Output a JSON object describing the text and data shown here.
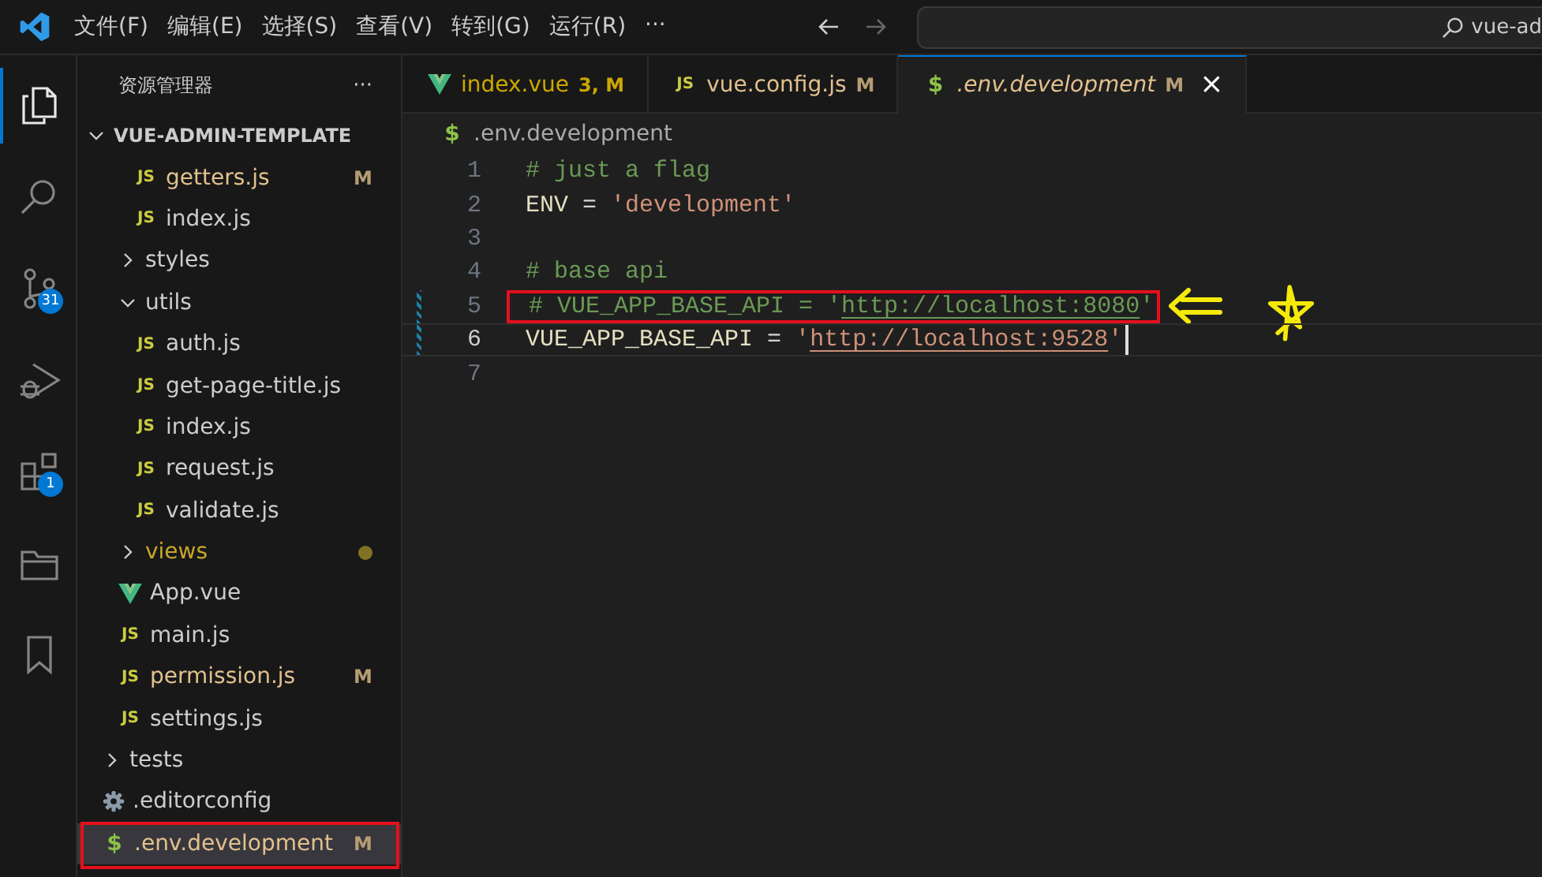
{
  "menu_bar": {
    "items": [
      "文件(F)",
      "编辑(E)",
      "选择(S)",
      "查看(V)",
      "转到(G)",
      "运行(R)",
      "···"
    ],
    "search": {
      "value": "vue-ad"
    }
  },
  "activity_bar": [
    {
      "kind": "files",
      "selected": true
    },
    {
      "kind": "search",
      "selected": false
    },
    {
      "kind": "source-control",
      "selected": false,
      "badge": "31"
    },
    {
      "kind": "debug",
      "selected": false
    },
    {
      "kind": "extensions",
      "selected": false,
      "badge": "1"
    },
    {
      "kind": "folder",
      "selected": false
    },
    {
      "kind": "bookmark",
      "selected": false
    }
  ],
  "sidebar": {
    "title": "资源管理器",
    "more": "···",
    "root": {
      "name": "VUE-ADMIN-TEMPLATE",
      "kind": "folder",
      "expanded": true,
      "children": [
        {
          "kind": "folder",
          "children": [
            {
              "kind": "folder",
              "children": [
                {
                  "name": "getters.js",
                  "kind": "js",
                  "icon": "JS",
                  "status": "M",
                  "selected": false
                },
                {
                  "name": "index.js",
                  "kind": "js",
                  "icon": "JS",
                  "selected": false
                }
              ]
            },
            {
              "name": "styles",
              "kind": "folder",
              "expanded": false
            },
            {
              "name": "utils",
              "kind": "folder",
              "expanded": true,
              "children": [
                {
                  "name": "auth.js",
                  "kind": "js",
                  "icon": "JS",
                  "selected": false
                },
                {
                  "name": "get-page-title.js",
                  "kind": "js",
                  "icon": "JS",
                  "selected": false
                },
                {
                  "name": "index.js",
                  "kind": "js",
                  "icon": "JS",
                  "selected": false
                },
                {
                  "name": "request.js",
                  "kind": "js",
                  "icon": "JS",
                  "selected": false
                },
                {
                  "name": "validate.js",
                  "kind": "js",
                  "icon": "JS",
                  "selected": false
                }
              ]
            },
            {
              "name": "views",
              "kind": "folder",
              "expanded": false,
              "has_changes": true
            },
            {
              "name": "App.vue",
              "kind": "vue",
              "selected": false
            },
            {
              "name": "main.js",
              "kind": "js",
              "icon": "JS",
              "selected": false
            },
            {
              "name": "permission.js",
              "kind": "js",
              "icon": "JS",
              "status": "M",
              "selected": false
            },
            {
              "name": "settings.js",
              "kind": "js",
              "icon": "JS",
              "selected": false
            }
          ]
        },
        {
          "name": "tests",
          "kind": "folder",
          "expanded": false
        },
        {
          "name": ".editorconfig",
          "kind": "config",
          "selected": false
        },
        {
          "name": ".env.development",
          "kind": "env",
          "icon": "$",
          "status": "M",
          "selected": true,
          "highlighted": true
        }
      ]
    }
  },
  "tabs": [
    {
      "name": "index.vue",
      "kind": "vue",
      "status": "3, M",
      "selected": false,
      "preview": false
    },
    {
      "name": "vue.config.js",
      "kind": "js",
      "icon": "JS",
      "status": "M",
      "selected": false,
      "preview": false
    },
    {
      "name": ".env.development",
      "kind": "env",
      "icon": "$",
      "status": "M",
      "selected": true,
      "preview": true,
      "close": "×"
    }
  ],
  "breadcrumb": {
    "kind": "env",
    "icon": "$",
    "name": ".env.development"
  },
  "code_lines": [
    {
      "number": "1",
      "segments": [
        {
          "kind": "comment",
          "text": "# just a flag"
        }
      ]
    },
    {
      "number": "2",
      "segments": [
        {
          "kind": "key",
          "text": "ENV"
        },
        {
          "kind": "op",
          "text": " = "
        },
        {
          "kind": "string",
          "text": "'development'"
        }
      ]
    },
    {
      "number": "3"
    },
    {
      "number": "4",
      "segments": [
        {
          "kind": "comment",
          "text": "# base api"
        }
      ]
    },
    {
      "number": "5",
      "modified": true,
      "highlighted": true,
      "current": false,
      "segments": [
        {
          "kind": "comment",
          "text": "# VUE_APP_BASE_API = '"
        },
        {
          "kind": "comment-link",
          "text": "http://localhost:8080"
        },
        {
          "kind": "comment",
          "text": "'"
        }
      ]
    },
    {
      "number": "6",
      "modified": true,
      "highlighted": false,
      "current": true,
      "segments": [
        {
          "kind": "key",
          "text": "VUE_APP_BASE_API"
        },
        {
          "kind": "op",
          "text": " = "
        },
        {
          "kind": "string",
          "text": "'"
        },
        {
          "kind": "string-link",
          "text": "http://localhost:9528"
        },
        {
          "kind": "string",
          "text": "'"
        }
      ]
    },
    {
      "number": "7"
    }
  ]
}
